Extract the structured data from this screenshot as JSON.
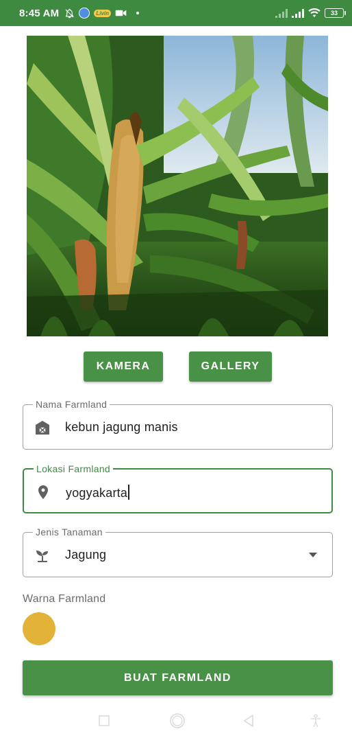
{
  "status_bar": {
    "time": "8:45 AM",
    "battery": "33",
    "app_badge": "Livin"
  },
  "photo": {
    "icon": "corn-field-photo"
  },
  "actions": {
    "camera_label": "KAMERA",
    "gallery_label": "GALLERY"
  },
  "form": {
    "name": {
      "label": "Nama Farmland",
      "value": "kebun jagung manis",
      "icon": "barn-icon"
    },
    "location": {
      "label": "Lokasi Farmland",
      "value": "yogyakarta",
      "icon": "location-pin-icon"
    },
    "crop": {
      "label": "Jenis Tanaman",
      "value": "Jagung",
      "icon": "sprout-icon"
    },
    "color": {
      "label": "Warna Farmland",
      "value": "#e2b338"
    }
  },
  "submit_label": "BUAT FARMLAND",
  "colors": {
    "primary": "#4a9148",
    "status_bar": "#3f8a41",
    "swatch": "#e2b338"
  }
}
